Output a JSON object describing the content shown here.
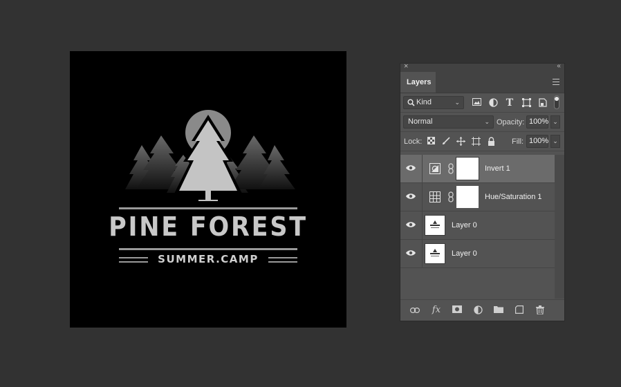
{
  "canvas": {
    "logo_title": "PINE FOREST",
    "logo_subtitle": "SUMMER.CAMP"
  },
  "panel": {
    "close_glyph": "×",
    "collapse_glyph": "‹‹",
    "tab_label": "Layers",
    "filter": {
      "label": "Kind",
      "icons": [
        "image-filter-icon",
        "adjustment-filter-icon",
        "type-filter-icon",
        "shape-filter-icon",
        "smart-object-filter-icon",
        "filter-toggle-icon"
      ]
    },
    "blend_mode": "Normal",
    "opacity_label": "Opacity:",
    "opacity_value": "100%",
    "lock_label": "Lock:",
    "fill_label": "Fill:",
    "fill_value": "100%",
    "layers": [
      {
        "name": "Invert 1",
        "type": "adjustment",
        "icon": "invert-icon",
        "selected": true
      },
      {
        "name": "Hue/Saturation 1",
        "type": "adjustment",
        "icon": "hue-saturation-icon",
        "selected": false
      },
      {
        "name": "Layer 0",
        "type": "pixel",
        "selected": false
      },
      {
        "name": "Layer 0",
        "type": "pixel",
        "selected": false
      }
    ],
    "bottom_icons": [
      "link-layers-icon",
      "fx-icon",
      "add-mask-icon",
      "new-adjustment-icon",
      "new-group-icon",
      "new-layer-icon",
      "delete-layer-icon"
    ]
  }
}
